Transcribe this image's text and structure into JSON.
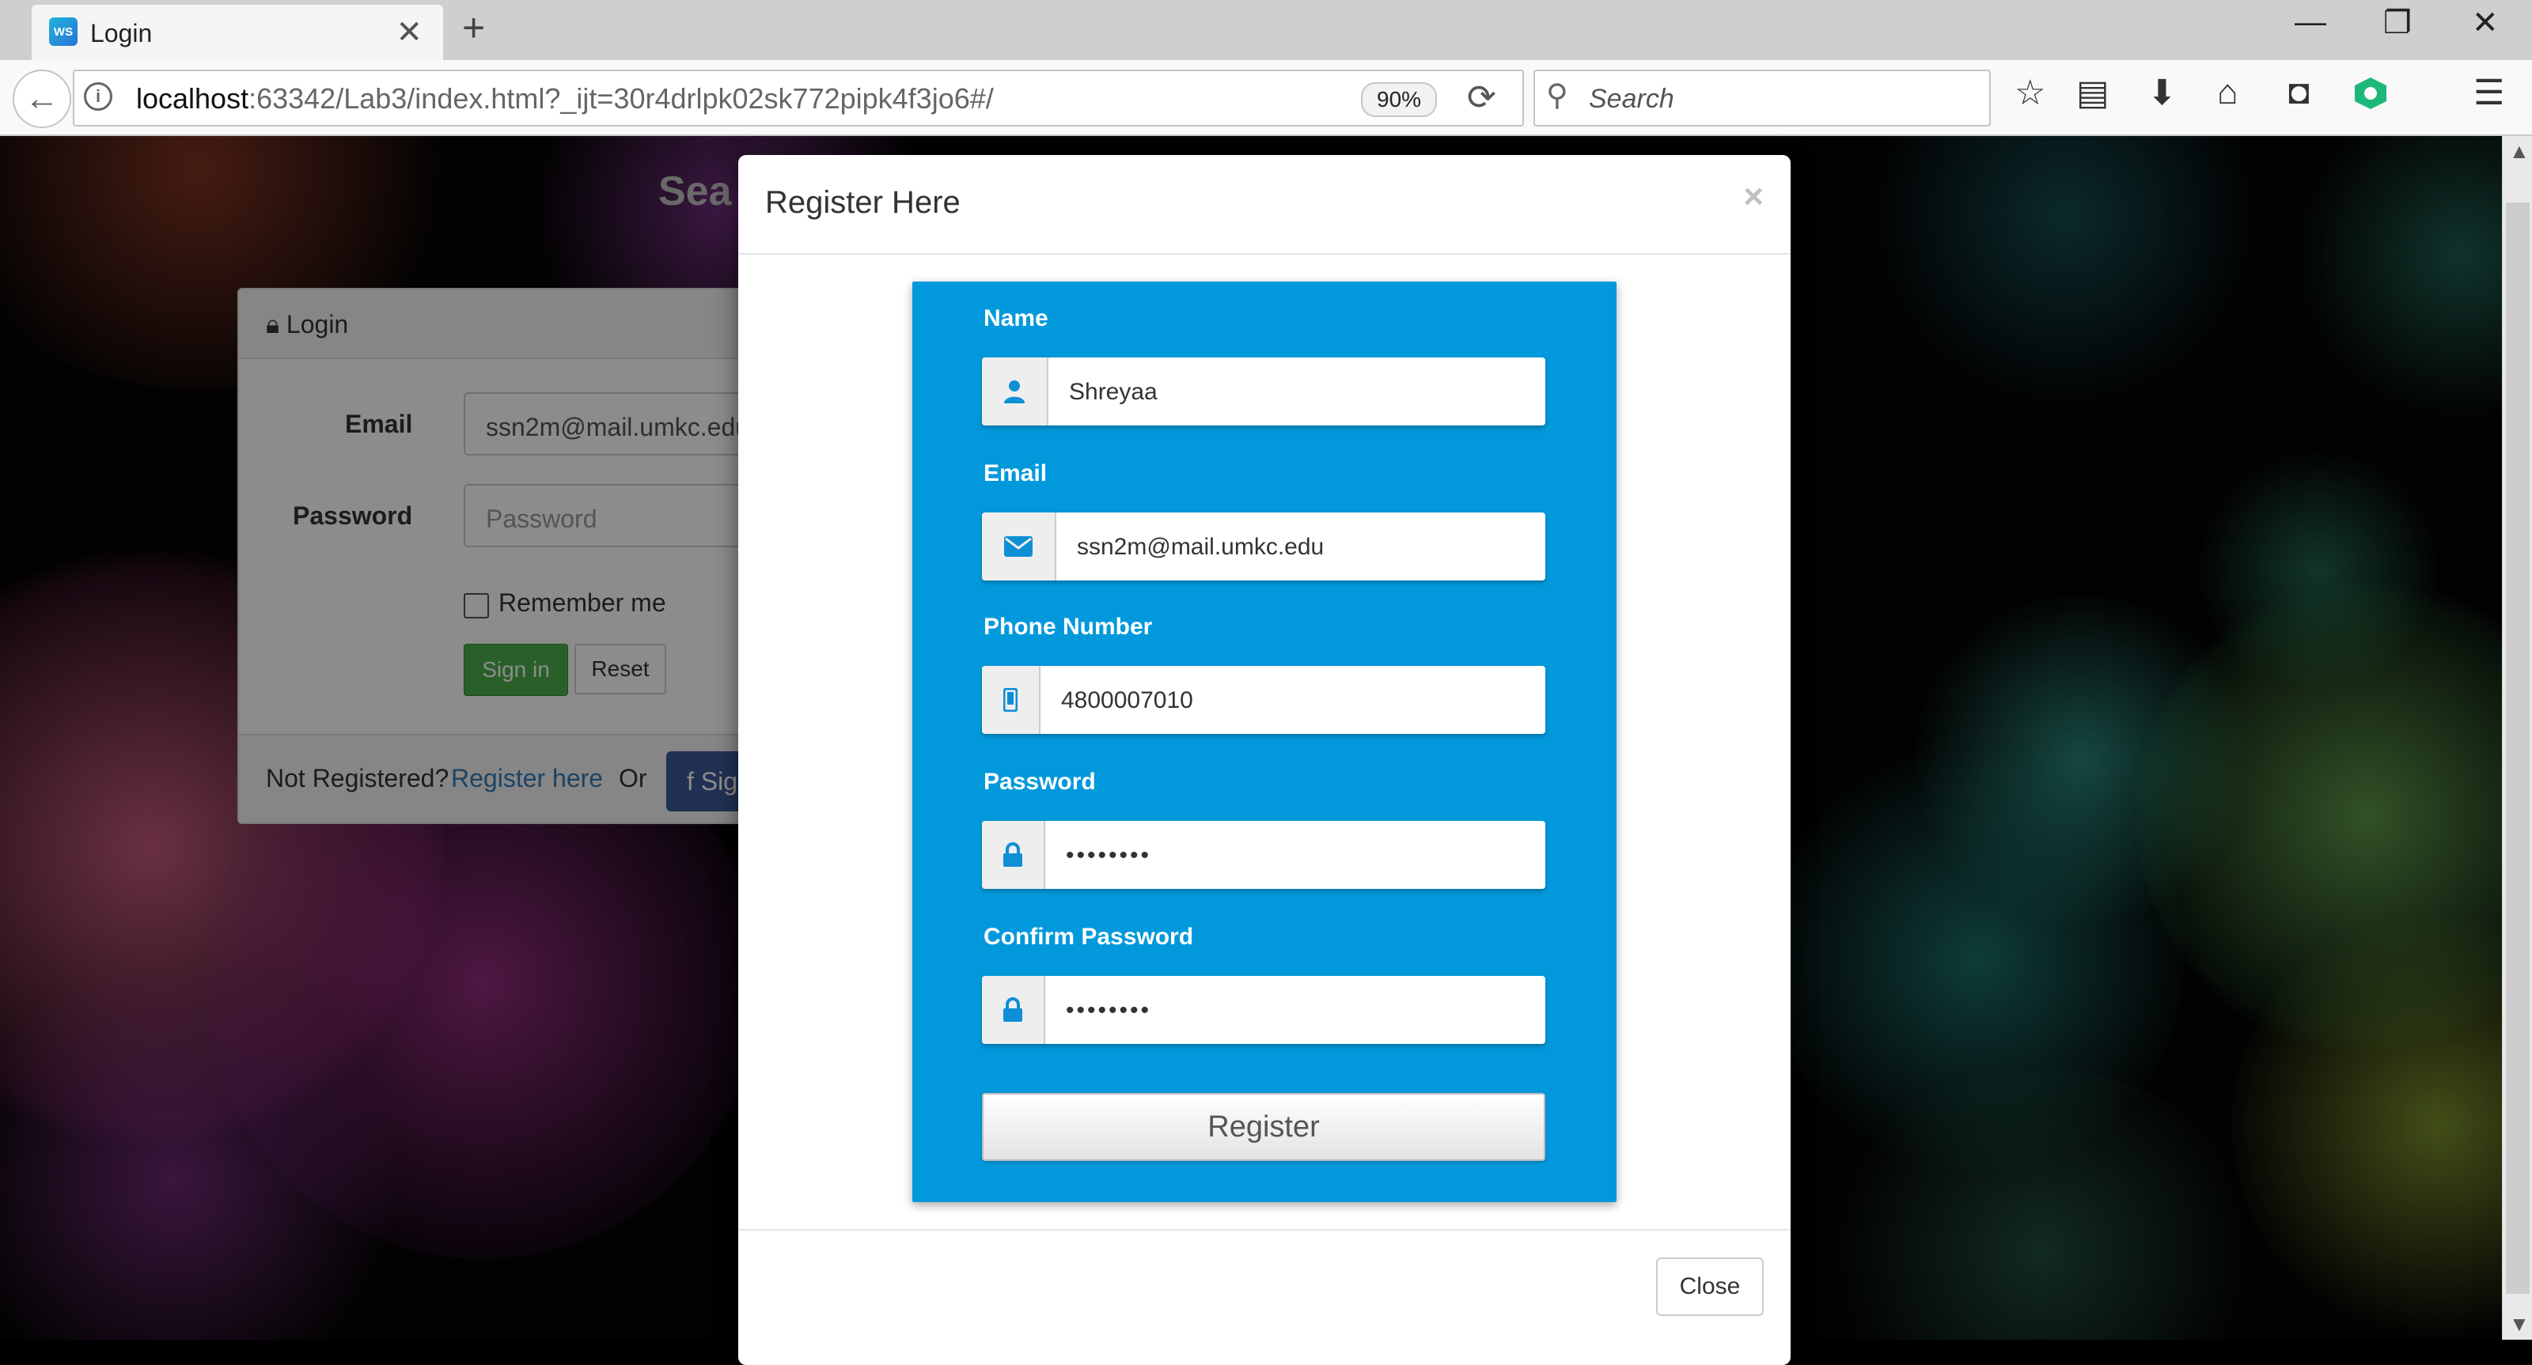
{
  "browser": {
    "tab_title": "Login",
    "tab_favicon_text": "WS",
    "url_host": "localhost",
    "url_rest": ":63342/Lab3/index.html?_ijt=30r4drlpk02sk772pipk4f3jo6#/",
    "zoom": "90%",
    "search_placeholder": "Search"
  },
  "page": {
    "site_title": "Sea",
    "login_panel": {
      "heading": "Login",
      "email_label": "Email",
      "email_value": "ssn2m@mail.umkc.edu",
      "password_label": "Password",
      "password_placeholder": "Password",
      "remember_label": "Remember me",
      "sign_in_label": "Sign in",
      "reset_label": "Reset",
      "not_registered_text": "Not Registered?",
      "register_link": "Register here",
      "or_text": "Or",
      "facebook_label": "Sig"
    }
  },
  "modal": {
    "title": "Register Here",
    "close_x": "×",
    "fields": {
      "name": {
        "label": "Name",
        "value": "Shreyaa"
      },
      "email": {
        "label": "Email",
        "value": "ssn2m@mail.umkc.edu"
      },
      "phone": {
        "label": "Phone Number",
        "value": "4800007010"
      },
      "password": {
        "label": "Password",
        "value": "••••••••"
      },
      "confirm_password": {
        "label": "Confirm Password",
        "value": "••••••••"
      }
    },
    "register_label": "Register",
    "close_label": "Close"
  },
  "colors": {
    "card_blue": "#0299dc",
    "icon_blue": "#0e8fd6",
    "sign_in_green": "#4cae4c",
    "link_blue": "#337ab7",
    "facebook_blue": "#3b5998"
  },
  "icons": [
    "user-icon",
    "envelope-icon",
    "mobile-icon",
    "lock-icon",
    "star-icon",
    "home-icon",
    "download-icon",
    "pocket-icon",
    "menu-icon"
  ]
}
